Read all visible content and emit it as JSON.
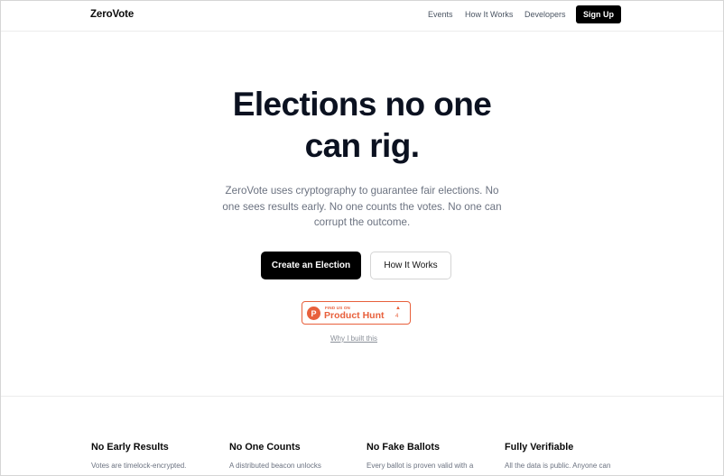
{
  "nav": {
    "logo": "ZeroVote",
    "links": [
      "Events",
      "How It Works",
      "Developers"
    ],
    "signup_label": "Sign Up"
  },
  "hero": {
    "title_line1": "Elections no one",
    "title_line2": "can rig.",
    "subtitle_line1": "ZeroVote uses cryptography to guarantee fair elections. No",
    "subtitle_line2": "one sees results early. No one counts the votes. No one can",
    "subtitle_line3": "corrupt the outcome.",
    "primary_cta": "Create an Election",
    "secondary_cta": "How It Works"
  },
  "product_hunt": {
    "small_label": "FIND US ON",
    "name": "Product Hunt",
    "arrow": "▲",
    "count": "4",
    "logo_letter": "P"
  },
  "why_link": "Why I built this",
  "features": [
    {
      "title": "No Early Results",
      "desc": "Votes are timelock-encrypted."
    },
    {
      "title": "No One Counts",
      "desc": "A distributed beacon unlocks"
    },
    {
      "title": "No Fake Ballots",
      "desc": "Every ballot is proven valid with a"
    },
    {
      "title": "Fully Verifiable",
      "desc": "All the data is public. Anyone can"
    }
  ],
  "colors": {
    "accent": "#000000",
    "product_hunt": "#e8603c",
    "muted_text": "#6b7280"
  }
}
